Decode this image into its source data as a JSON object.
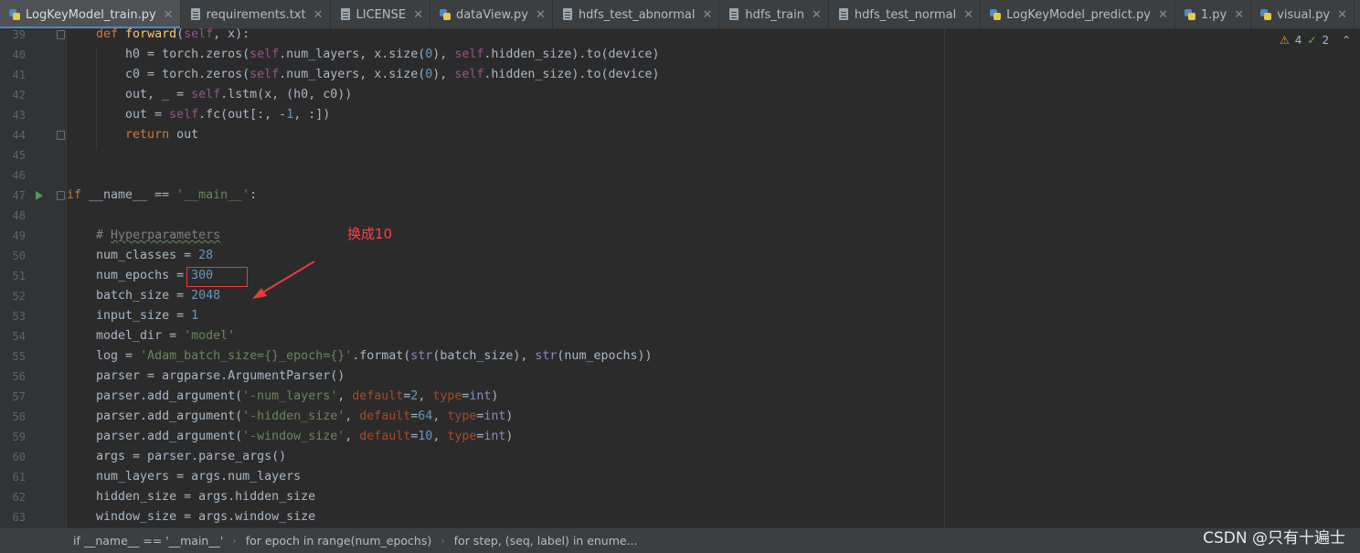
{
  "tabs": [
    {
      "label": "LogKeyModel_train.py",
      "icon": "python-file-icon",
      "active": true
    },
    {
      "label": "requirements.txt",
      "icon": "text-file-icon"
    },
    {
      "label": "LICENSE",
      "icon": "text-file-icon"
    },
    {
      "label": "dataView.py",
      "icon": "python-file-icon"
    },
    {
      "label": "hdfs_test_abnormal",
      "icon": "text-file-icon"
    },
    {
      "label": "hdfs_train",
      "icon": "text-file-icon"
    },
    {
      "label": "hdfs_test_normal",
      "icon": "text-file-icon"
    },
    {
      "label": "LogKeyModel_predict.py",
      "icon": "python-file-icon"
    },
    {
      "label": "1.py",
      "icon": "python-file-icon"
    },
    {
      "label": "visual.py",
      "icon": "python-file-icon"
    }
  ],
  "tab_close_glyph": "✕",
  "inspection": {
    "warnings": "4",
    "weak_warnings": "2"
  },
  "code_lines": [
    {
      "n": "39",
      "t": [
        [
          "kw",
          "    def "
        ],
        [
          "fn",
          "forward"
        ],
        [
          "",
          "("
        ],
        [
          "sf",
          "self"
        ],
        [
          "",
          ", x):"
        ]
      ]
    },
    {
      "n": "40",
      "t": [
        [
          "",
          "        h0 = torch.zeros("
        ],
        [
          "sf",
          "self"
        ],
        [
          "",
          ".num_layers, x.size("
        ],
        [
          "num",
          "0"
        ],
        [
          "",
          "), "
        ],
        [
          "sf",
          "self"
        ],
        [
          "",
          ".hidden_size).to(device)"
        ]
      ]
    },
    {
      "n": "41",
      "t": [
        [
          "",
          "        c0 = torch.zeros("
        ],
        [
          "sf",
          "self"
        ],
        [
          "",
          ".num_layers, x.size("
        ],
        [
          "num",
          "0"
        ],
        [
          "",
          "), "
        ],
        [
          "sf",
          "self"
        ],
        [
          "",
          ".hidden_size).to(device)"
        ]
      ]
    },
    {
      "n": "42",
      "t": [
        [
          "",
          "        out, _ = "
        ],
        [
          "sf",
          "self"
        ],
        [
          "",
          ".lstm(x, (h0, c0))"
        ]
      ]
    },
    {
      "n": "43",
      "t": [
        [
          "",
          "        out = "
        ],
        [
          "sf",
          "self"
        ],
        [
          "",
          ".fc(out[:, -"
        ],
        [
          "num",
          "1"
        ],
        [
          "",
          ", :])"
        ]
      ]
    },
    {
      "n": "44",
      "t": [
        [
          "kw",
          "        return "
        ],
        [
          "",
          "out"
        ]
      ]
    },
    {
      "n": "45",
      "t": []
    },
    {
      "n": "46",
      "t": []
    },
    {
      "n": "47",
      "t": [
        [
          "kw",
          "if "
        ],
        [
          "",
          "__name__ == "
        ],
        [
          "str",
          "'__main__'"
        ],
        [
          "",
          ":"
        ]
      ]
    },
    {
      "n": "48",
      "t": []
    },
    {
      "n": "49",
      "t": [
        [
          "cm",
          "    # "
        ],
        [
          "cm typo",
          "Hyperparameters"
        ]
      ]
    },
    {
      "n": "50",
      "t": [
        [
          "",
          "    num_classes = "
        ],
        [
          "num",
          "28"
        ]
      ]
    },
    {
      "n": "51",
      "t": [
        [
          "",
          "    num_epochs = "
        ],
        [
          "num",
          "300"
        ]
      ]
    },
    {
      "n": "52",
      "t": [
        [
          "",
          "    batch_size = "
        ],
        [
          "num",
          "2048"
        ]
      ]
    },
    {
      "n": "53",
      "t": [
        [
          "",
          "    input_size = "
        ],
        [
          "num",
          "1"
        ]
      ]
    },
    {
      "n": "54",
      "t": [
        [
          "",
          "    model_dir = "
        ],
        [
          "str",
          "'model'"
        ]
      ]
    },
    {
      "n": "55",
      "t": [
        [
          "",
          "    log = "
        ],
        [
          "str",
          "'Adam_batch_size={}_epoch={}'"
        ],
        [
          "",
          ".format("
        ],
        [
          "bi",
          "str"
        ],
        [
          "",
          "(batch_size), "
        ],
        [
          "bi",
          "str"
        ],
        [
          "",
          "(num_epochs))"
        ]
      ]
    },
    {
      "n": "56",
      "t": [
        [
          "",
          "    parser = argparse.ArgumentParser()"
        ]
      ]
    },
    {
      "n": "57",
      "t": [
        [
          "",
          "    parser.add_argument("
        ],
        [
          "str",
          "'-num_layers'"
        ],
        [
          "",
          ", "
        ],
        [
          "pm",
          "default"
        ],
        [
          "",
          "="
        ],
        [
          "num",
          "2"
        ],
        [
          "",
          ", "
        ],
        [
          "pm",
          "type"
        ],
        [
          "",
          "="
        ],
        [
          "bi",
          "int"
        ],
        [
          "",
          ")"
        ]
      ]
    },
    {
      "n": "58",
      "t": [
        [
          "",
          "    parser.add_argument("
        ],
        [
          "str",
          "'-hidden_size'"
        ],
        [
          "",
          ", "
        ],
        [
          "pm",
          "default"
        ],
        [
          "",
          "="
        ],
        [
          "num",
          "64"
        ],
        [
          "",
          ", "
        ],
        [
          "pm",
          "type"
        ],
        [
          "",
          "="
        ],
        [
          "bi",
          "int"
        ],
        [
          "",
          ")"
        ]
      ]
    },
    {
      "n": "59",
      "t": [
        [
          "",
          "    parser.add_argument("
        ],
        [
          "str",
          "'-window_size'"
        ],
        [
          "",
          ", "
        ],
        [
          "pm",
          "default"
        ],
        [
          "",
          "="
        ],
        [
          "num",
          "10"
        ],
        [
          "",
          ", "
        ],
        [
          "pm",
          "type"
        ],
        [
          "",
          "="
        ],
        [
          "bi",
          "int"
        ],
        [
          "",
          ")"
        ]
      ]
    },
    {
      "n": "60",
      "t": [
        [
          "",
          "    args = parser.parse_args()"
        ]
      ]
    },
    {
      "n": "61",
      "t": [
        [
          "",
          "    num_layers = args.num_layers"
        ]
      ]
    },
    {
      "n": "62",
      "t": [
        [
          "",
          "    hidden_size = args.hidden_size"
        ]
      ]
    },
    {
      "n": "63",
      "t": [
        [
          "",
          "    window_size = args.window_size"
        ]
      ]
    }
  ],
  "annotation": {
    "text": "换成10",
    "color": "#ff4040"
  },
  "breadcrumbs": [
    "if __name__ == '__main__'",
    "for epoch in range(num_epochs)",
    "for step, (seq, label) in enume..."
  ],
  "watermark": "CSDN @只有十遍士",
  "colors": {
    "background": "#2b2b2b",
    "keyword": "#cc7832",
    "self": "#94558d",
    "number": "#6897bb",
    "string": "#6a8759",
    "comment": "#808080",
    "function": "#ffc66d",
    "builtin": "#8888c6",
    "param": "#aa4926",
    "accent": "#4a88c7"
  }
}
